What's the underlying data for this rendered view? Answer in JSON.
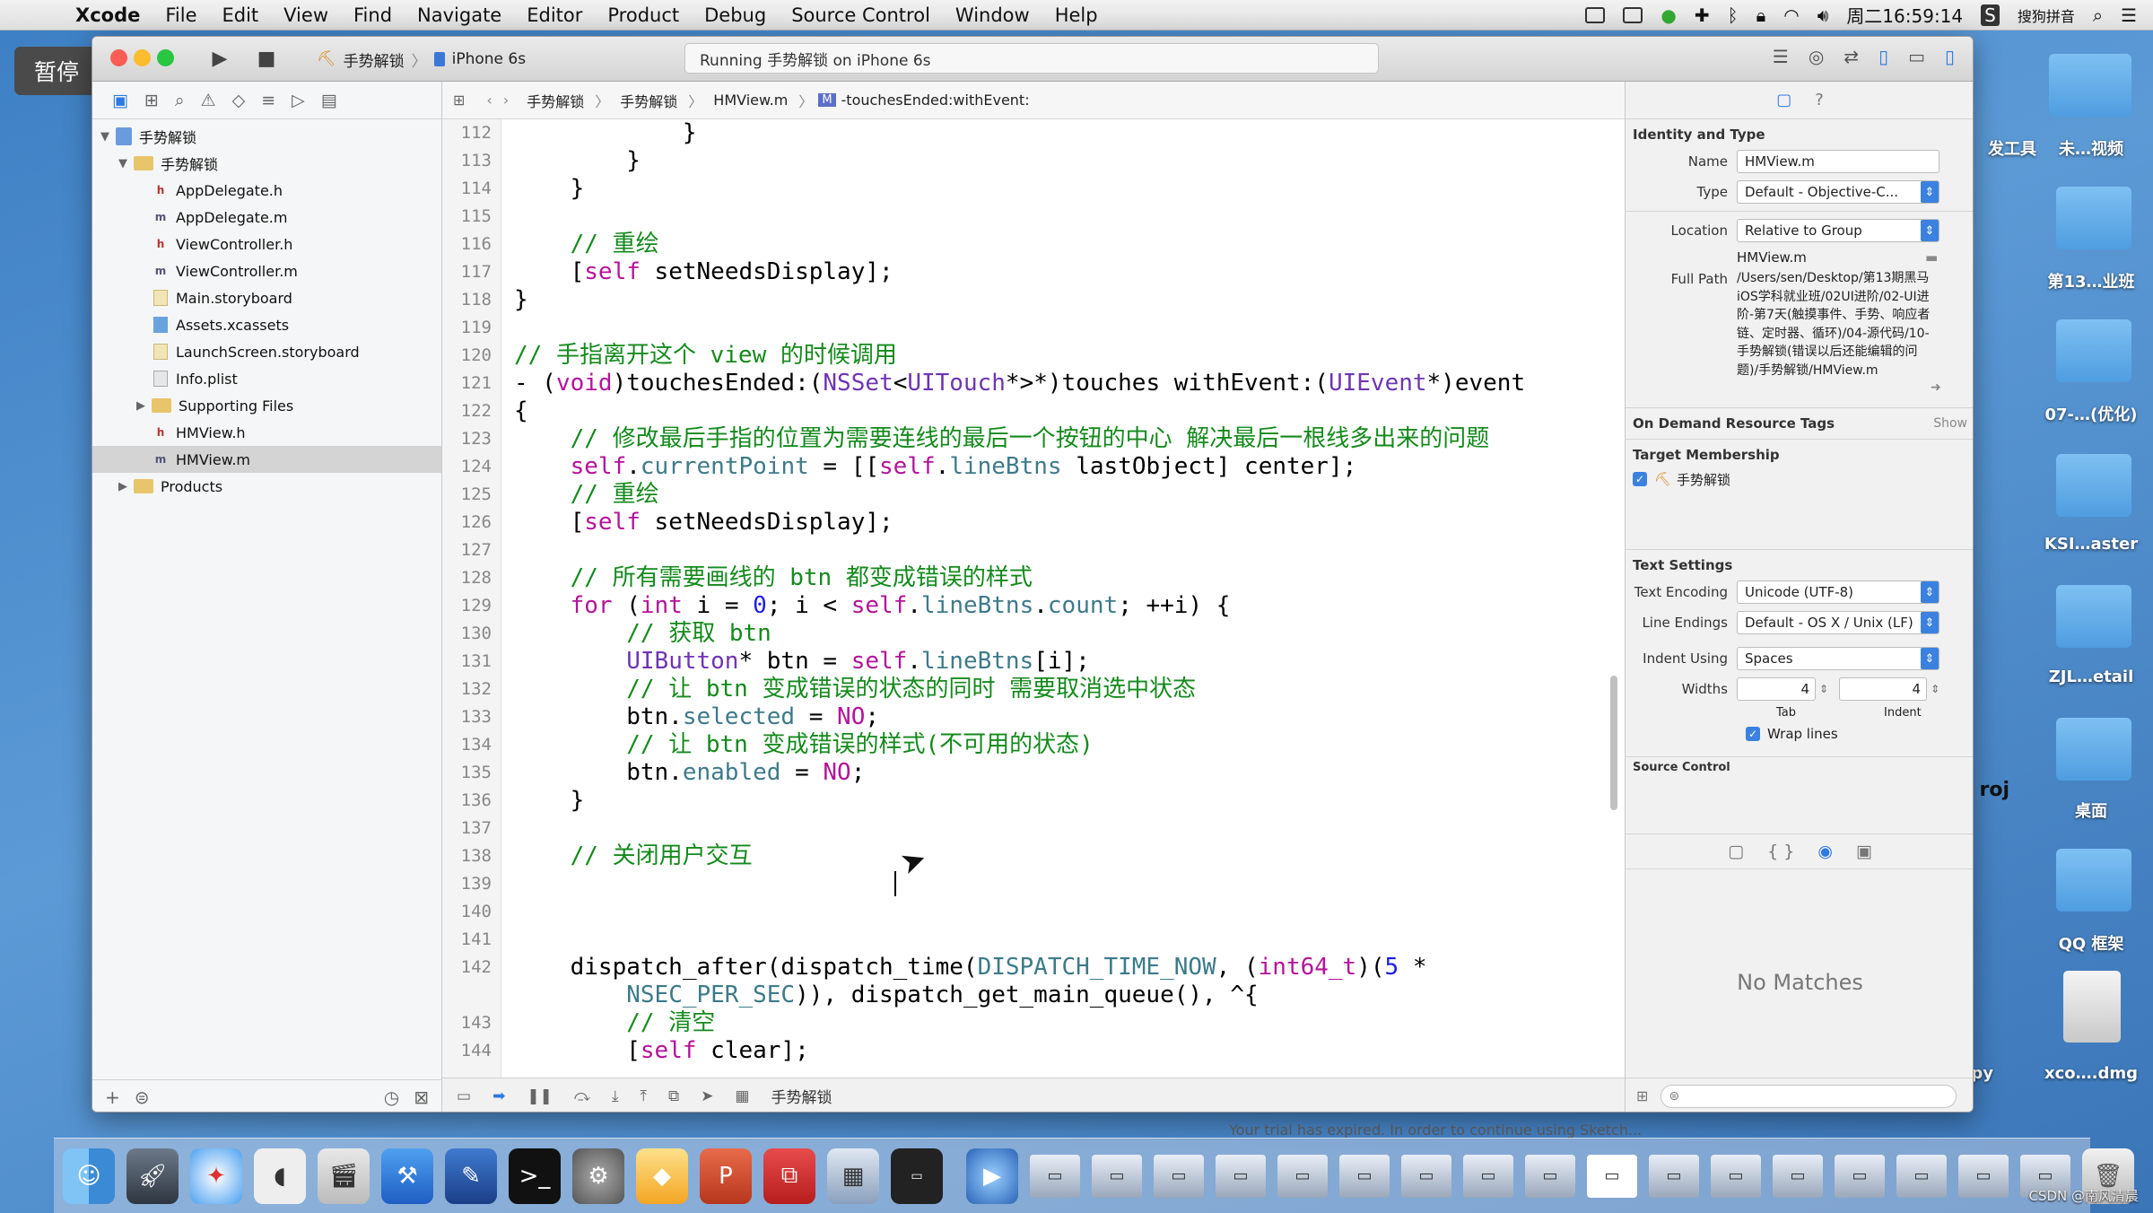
{
  "menubar": {
    "items": [
      "Xcode",
      "File",
      "Edit",
      "View",
      "Find",
      "Navigate",
      "Editor",
      "Product",
      "Debug",
      "Source Control",
      "Window",
      "Help"
    ],
    "clock": "周二16:59:14",
    "input_method": "搜狗拼音"
  },
  "pause_badge": "暂停",
  "toolbar": {
    "scheme": "手势解锁",
    "device": "iPhone 6s",
    "status": "Running 手势解锁 on iPhone 6s"
  },
  "navigator": {
    "project": "手势解锁",
    "group": "手势解锁",
    "files": [
      "AppDelegate.h",
      "AppDelegate.m",
      "ViewController.h",
      "ViewController.m",
      "Main.storyboard",
      "Assets.xcassets",
      "LaunchScreen.storyboard",
      "Info.plist",
      "Supporting Files",
      "HMView.h",
      "HMView.m",
      "Products"
    ]
  },
  "jumpbar": {
    "project": "手势解锁",
    "group": "手势解锁",
    "file": "HMView.m",
    "method": "-touchesEnded:withEvent:"
  },
  "code": {
    "line_numbers": [
      "112",
      "113",
      "114",
      "115",
      "116",
      "117",
      "118",
      "119",
      "120",
      "121",
      "122",
      "123",
      "124",
      "125",
      "126",
      "127",
      "128",
      "129",
      "130",
      "131",
      "132",
      "133",
      "134",
      "135",
      "136",
      "137",
      "138",
      "139",
      "140",
      "141",
      "142",
      "",
      "143",
      "144"
    ]
  },
  "debugbar": {
    "target": "手势解锁"
  },
  "inspector": {
    "identity_title": "Identity and Type",
    "name_label": "Name",
    "name_value": "HMView.m",
    "type_label": "Type",
    "type_value": "Default - Objective-C...",
    "location_label": "Location",
    "location_value": "Relative to Group",
    "location_file": "HMView.m",
    "fullpath_label": "Full Path",
    "fullpath_value": "/Users/sen/Desktop/第13期黑马iOS学科就业班/02UI进阶/02-UI进阶-第7天(触摸事件、手势、响应者链、定时器、循环)/04-源代码/10-手势解锁(错误以后还能编辑的问题)/手势解锁/HMView.m",
    "odr_title": "On Demand Resource Tags",
    "odr_show": "Show",
    "tm_title": "Target Membership",
    "tm_target": "手势解锁",
    "ts_title": "Text Settings",
    "enc_label": "Text Encoding",
    "enc_value": "Unicode (UTF-8)",
    "le_label": "Line Endings",
    "le_value": "Default - OS X / Unix (LF)",
    "indent_label": "Indent Using",
    "indent_value": "Spaces",
    "widths_label": "Widths",
    "tab_value": "4",
    "indent_width_value": "4",
    "tab_caption": "Tab",
    "indent_caption": "Indent",
    "wrap_label": "Wrap lines",
    "sc_title": "Source Control",
    "no_matches": "No Matches"
  },
  "desktop": {
    "labels": [
      "发工具",
      "未…视频",
      "第13…业班",
      "07-…(优化)",
      "KSI…aster",
      "ZJL…etail",
      "桌面",
      "QQ 框架",
      "xco….dmg",
      "roj",
      "opy"
    ]
  },
  "trial_text": "Your trial has expired. In order to continue using Sketch...",
  "watermark": "CSDN @南风清晨"
}
